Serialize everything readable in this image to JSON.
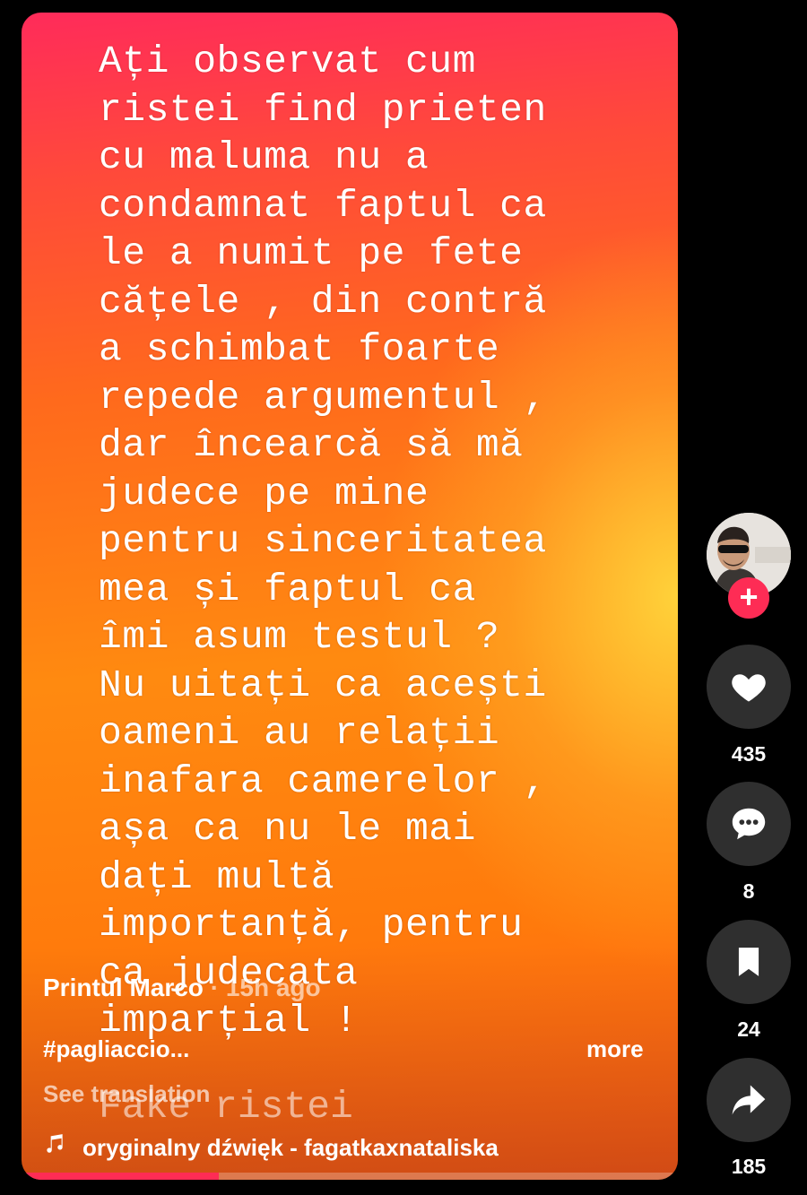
{
  "video": {
    "overlay_lines": [
      "Ați observat cum",
      "ristei find prieten",
      "cu maluma nu a",
      "condamnat faptul ca",
      "le a numit pe fete",
      "cățele , din contră",
      "a schimbat foarte",
      "repede argumentul ,",
      "dar încearcă să mă",
      "judece pe mine",
      "pentru sinceritatea",
      "mea și faptul ca",
      "îmi asum testul ?",
      "Nu uitați ca acești",
      "oameni au relații",
      "inafara camerelor ,",
      "așa ca nu le mai",
      "dați multă",
      "importanță, pentru",
      "ca judecata",
      "imparțial !"
    ],
    "overlay_footer": "Fake ristei",
    "progress": 0.3
  },
  "post": {
    "author": "Printul Marco",
    "separator": "·",
    "time_ago": "15h ago",
    "hashtag": "#pagliaccio...",
    "more_label": "more",
    "see_translation": "See translation",
    "music_icon": "music-note-icon",
    "sound": "oryginalny dźwięk - fagatkaxnataliska"
  },
  "actions": {
    "avatar_badge": "+",
    "likes": "435",
    "comments": "8",
    "saves": "24",
    "shares": "185"
  },
  "colors": {
    "accent": "#fe2c55",
    "button_bg": "#2f2f2f"
  }
}
